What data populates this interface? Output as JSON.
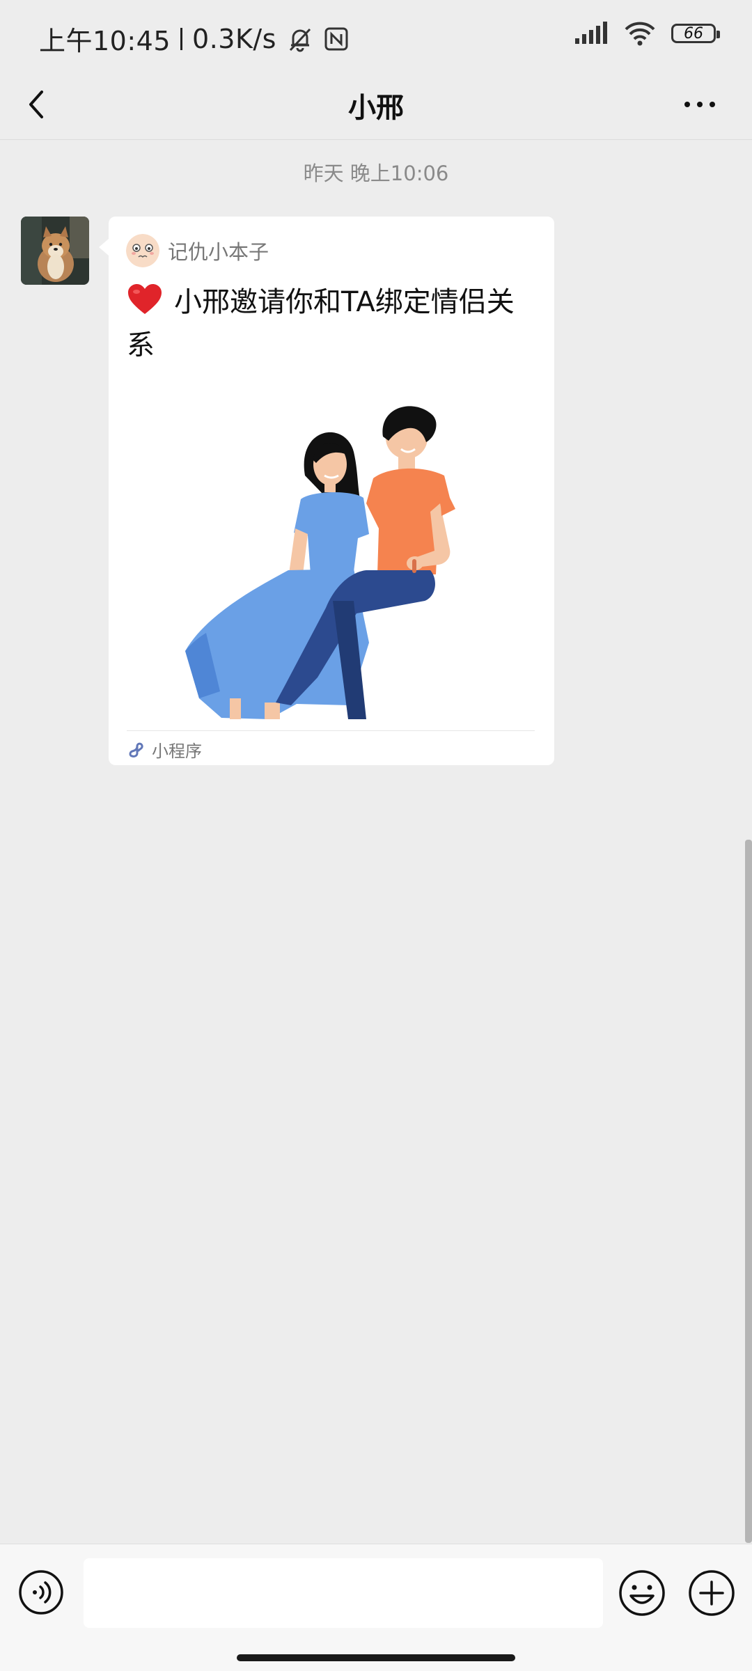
{
  "status_bar": {
    "time": "上午10:45",
    "network_speed": "0.3K/s",
    "battery_level": "66",
    "icons": [
      "mute-bell-icon",
      "nfc-icon",
      "signal-icon",
      "wifi-icon",
      "battery-icon"
    ]
  },
  "nav": {
    "title": "小邢",
    "icons": [
      "back-chevron-icon",
      "more-dots-icon"
    ]
  },
  "chat": {
    "timestamp": "昨天 晚上10:06",
    "message": {
      "mini_program_name": "记仇小本子",
      "title": "小邢邀请你和TA绑定情侣关系",
      "footer_label": "小程序",
      "icons": [
        "heart-icon",
        "mini-program-icon",
        "couple-illustration"
      ]
    }
  },
  "input_bar": {
    "icons": [
      "voice-icon",
      "emoji-icon",
      "plus-icon"
    ]
  },
  "colors": {
    "background": "#ededed",
    "card": "#ffffff",
    "heart": "#e0242a",
    "shirt_orange": "#f5834f",
    "dress_blue": "#6aa0e6",
    "pants_navy": "#2c4a8f"
  }
}
